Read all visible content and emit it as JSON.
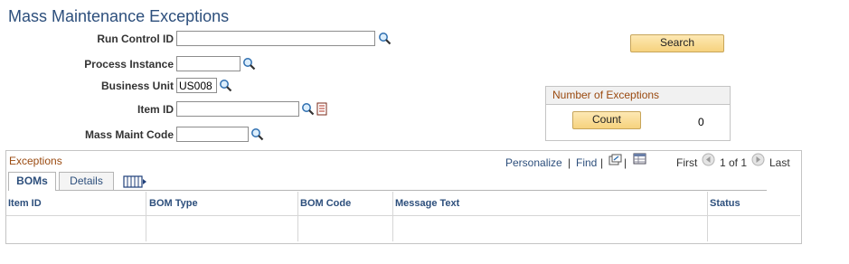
{
  "page": {
    "title": "Mass Maintenance Exceptions"
  },
  "form": {
    "run_control_id": {
      "label": "Run Control ID",
      "value": ""
    },
    "process_instance": {
      "label": "Process Instance",
      "value": ""
    },
    "business_unit": {
      "label": "Business Unit",
      "value": "US008"
    },
    "item_id": {
      "label": "Item ID",
      "value": ""
    },
    "mass_maint_code": {
      "label": "Mass Maint Code",
      "value": ""
    }
  },
  "search_button": {
    "label": "Search"
  },
  "exceptions_count": {
    "title": "Number of Exceptions",
    "count_button": "Count",
    "value": "0"
  },
  "grid": {
    "title": "Exceptions",
    "nav": {
      "personalize": "Personalize",
      "separator": "|",
      "find": "Find",
      "first": "First",
      "range": "1 of 1",
      "last": "Last"
    },
    "tabs": [
      {
        "label": "BOMs",
        "active": true
      },
      {
        "label": "Details",
        "active": false
      }
    ],
    "columns": [
      "Item ID",
      "BOM Type",
      "BOM Code",
      "Message Text",
      "Status"
    ],
    "rows": [
      [
        "",
        "",
        "",
        "",
        ""
      ]
    ]
  },
  "icons": {
    "lookup": "magnifier-icon",
    "detail": "detail-page-icon",
    "view_all": "view-all-columns-icon",
    "zoom": "zoom-icon",
    "download": "download-icon",
    "prev": "prev-arrow-icon",
    "next": "next-arrow-icon"
  },
  "colors": {
    "title": "#2d4f7c",
    "section_title": "#9a4a10",
    "button": "#f6d27e"
  }
}
